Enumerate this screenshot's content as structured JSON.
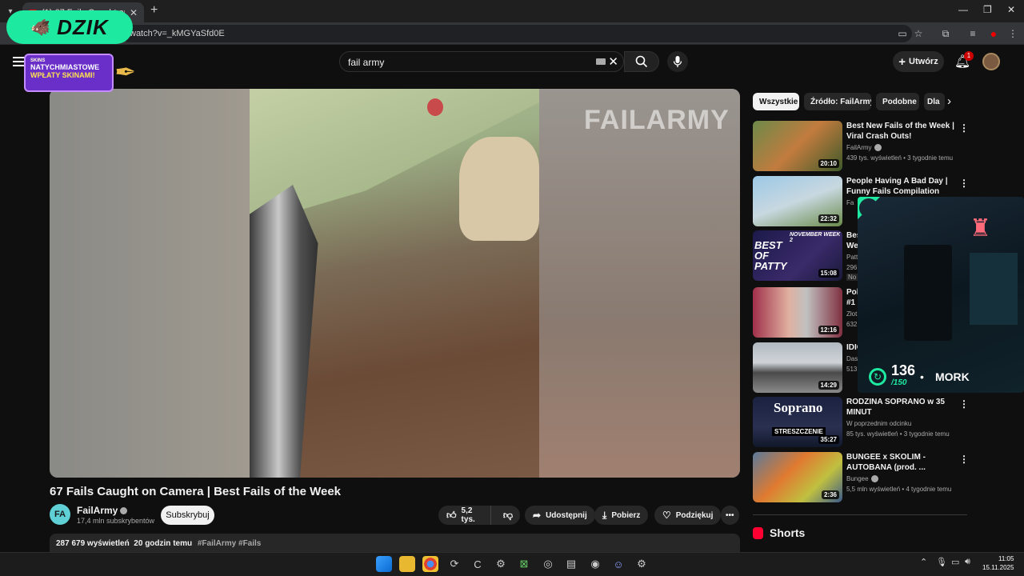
{
  "browser": {
    "tab_title": "(1) 67 Fails Caught on Cam",
    "url": "watch?v=_kMGYaSfd0E",
    "new_tab_glyph": "+",
    "minimize_glyph": "—",
    "maximize_glyph": "❐",
    "close_glyph": "✕"
  },
  "overlay": {
    "brand": "DZIK",
    "promo_small": "SKINS",
    "promo_line1": "NATYCHMIASTOWE",
    "promo_line2": "WPŁATY SKINAMI!",
    "counter_value": "136",
    "counter_max": "/150",
    "streamer_name": "MORK"
  },
  "youtube": {
    "search_value": "fail army",
    "create_label": "Utwórz",
    "notifications_count": "1",
    "video": {
      "watermark": "FAILARMY",
      "title": "67 Fails Caught on Camera | Best Fails of the Week",
      "channel_name": "FailArmy",
      "channel_initials": "FA",
      "subscribers": "17,4 mln subskrybentów",
      "subscribe_label": "Subskrybuj",
      "likes": "5,2 tys.",
      "share_label": "Udostępnij",
      "download_label": "Pobierz",
      "thanks_label": "Podziękuj",
      "views": "287 679 wyświetleń",
      "age": "20 godzin temu",
      "hashtags": "#FailArmy #Fails"
    },
    "chips": [
      "Wszystkie",
      "Źródło: FailArmy",
      "Podobne",
      "Dla"
    ],
    "recommendations": [
      {
        "title": "Best New Fails of the Week | Viral Crash Outs!",
        "channel": "FailArmy",
        "meta": "439 tys. wyświetleń • 3 tygodnie temu",
        "duration": "20:10"
      },
      {
        "title": "People Having A Bad Day | Funny Fails Compilation",
        "channel": "Fa",
        "meta": "",
        "duration": "22:32"
      },
      {
        "title": "Bes We",
        "channel": "Patt",
        "meta": "296",
        "badge": "No",
        "duration": "15:08",
        "thumb_text": "BEST OF PATTY",
        "thumb_sub": "NOVEMBER WEEK 2"
      },
      {
        "title": "Pol #1",
        "channel": "Złot",
        "meta": "632",
        "duration": "12:16"
      },
      {
        "title": "IDIO",
        "channel": "Dashcam Ac",
        "meta": "513",
        "duration": "14:29"
      },
      {
        "title": "RODZINA SOPRANO w 35 MINUT",
        "channel": "W poprzednim odcinku",
        "meta": "85 tys. wyświetleń • 3 tygodnie temu",
        "duration": "35:27",
        "thumb_text": "Soprano",
        "thumb_sub": "STRESZCZENIE"
      },
      {
        "title": "BUNGEE x SKOLIM - AUTOBANA (prod. ...",
        "channel": "Bungee",
        "meta": "5,5 mln wyświetleń • 4 tygodnie temu",
        "duration": "2:36"
      }
    ],
    "shorts_label": "Shorts"
  },
  "taskbar": {
    "time": "11:05",
    "date": "15.11.2025"
  },
  "colors": {
    "accent_green": "#1de9a0",
    "youtube_red": "#ff0000",
    "promo_purple": "#6a2fc9"
  }
}
